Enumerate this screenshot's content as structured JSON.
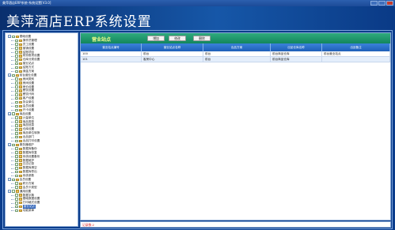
{
  "window": {
    "title": "美萍酒店ERP系统-系统设置[V3.0]"
  },
  "banner": {
    "title": "美萍酒店ERP系统设置"
  },
  "module": {
    "title": "营业站点"
  },
  "toolbar": {
    "add_label": "增加",
    "edit_label": "修改",
    "delete_label": "删除"
  },
  "tree": [
    {
      "label": "基础设置",
      "level": 0,
      "expander": "−"
    },
    {
      "label": "操作员管理",
      "level": 1
    },
    {
      "label": "员工设置",
      "level": 1
    },
    {
      "label": "营销设置",
      "level": 1
    },
    {
      "label": "结账项目",
      "level": 1
    },
    {
      "label": "财务账项设置",
      "level": 1
    },
    {
      "label": "仓库分类设置",
      "level": 1
    },
    {
      "label": "营业站点",
      "level": 1,
      "selected": false
    },
    {
      "label": "结账方式",
      "level": 1
    },
    {
      "label": "佣金方案",
      "level": 1
    },
    {
      "label": "前台营业设置",
      "level": 0,
      "expander": "−"
    },
    {
      "label": "房间类别",
      "level": 1
    },
    {
      "label": "房间设置",
      "level": 1
    },
    {
      "label": "房价设置",
      "level": 1
    },
    {
      "label": "餐饮设置",
      "level": 1
    },
    {
      "label": "餐饮代码",
      "level": 1
    },
    {
      "label": "客户设置",
      "level": 1
    },
    {
      "label": "协议单位",
      "level": 1
    },
    {
      "label": "会员设置",
      "level": 1
    },
    {
      "label": "开卡设置",
      "level": 1
    },
    {
      "label": "商品设置",
      "level": 0,
      "expander": "−"
    },
    {
      "label": "计量单位",
      "level": 1
    },
    {
      "label": "商品类型",
      "level": 1
    },
    {
      "label": "商品信息",
      "level": 1
    },
    {
      "label": "仓库设置",
      "level": 1
    },
    {
      "label": "商品单位转换",
      "level": 1
    },
    {
      "label": "出品部门",
      "level": 1
    },
    {
      "label": "出品打印设置",
      "level": 1
    },
    {
      "label": "服务器维护",
      "level": 0,
      "expander": "−"
    },
    {
      "label": "数据库备份",
      "level": 1
    },
    {
      "label": "数据库恢复",
      "level": 1
    },
    {
      "label": "系统设置备份",
      "level": 1
    },
    {
      "label": "数据维护",
      "level": 1
    },
    {
      "label": "日志记录",
      "level": 1
    },
    {
      "label": "数据库清空",
      "level": 1
    },
    {
      "label": "数据库导出",
      "level": 1
    },
    {
      "label": "系统参数",
      "level": 1
    },
    {
      "label": "会员设置",
      "level": 0,
      "expander": "−"
    },
    {
      "label": "积分方案",
      "level": 1
    },
    {
      "label": "会员卡类型",
      "level": 1
    },
    {
      "label": "通用设置",
      "level": 0,
      "expander": "−"
    },
    {
      "label": "数据字典",
      "level": 1
    },
    {
      "label": "基础数据设置",
      "level": 1
    },
    {
      "label": "打印格式设置",
      "level": 1
    },
    {
      "label": "营业站点",
      "level": 1,
      "selected": true
    },
    {
      "label": "功能菜单",
      "level": 1
    }
  ],
  "grid": {
    "columns": [
      "营业站点编号",
      "营业站点名称",
      "出品方案",
      "出品仓库名称",
      "出品备注"
    ],
    "rows": [
      [
        "100",
        "前台",
        "前台",
        "前台商品仓库",
        "前台营业站点"
      ],
      [
        "101",
        "客房中心",
        "前台",
        "前台商品仓库",
        ""
      ]
    ]
  },
  "status": {
    "text": "记录数:2"
  }
}
